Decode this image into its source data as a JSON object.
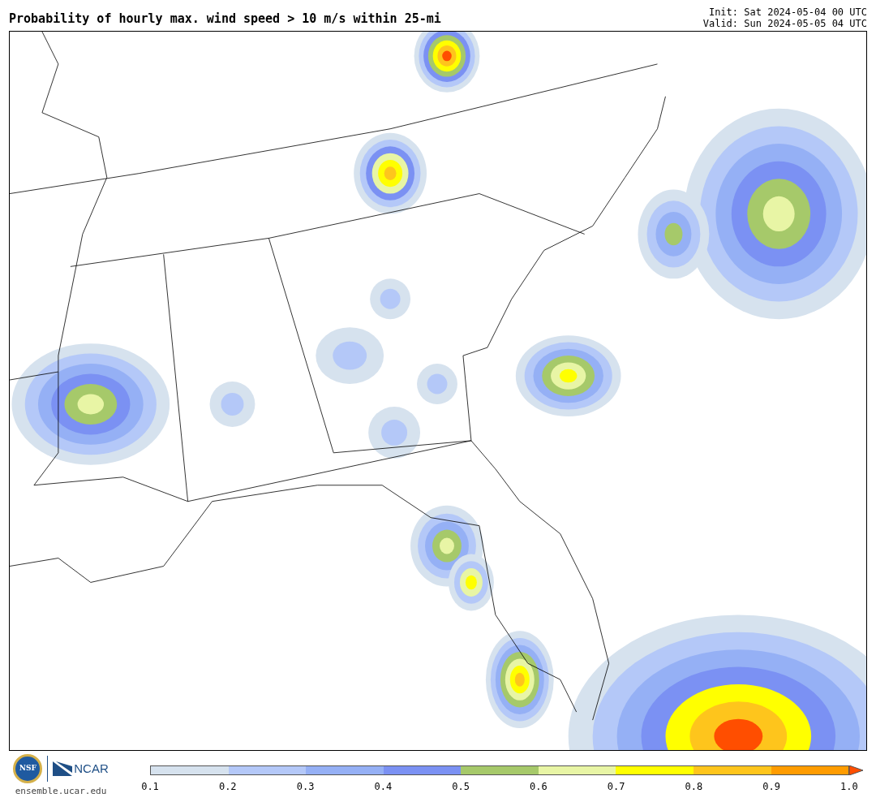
{
  "title": "Probability of hourly max. wind speed > 10 m/s within 25-mi",
  "init": "Init: Sat 2024-05-04 00 UTC",
  "valid": "Valid: Sun 2024-05-05 04 UTC",
  "logos": {
    "nsf": "NSF",
    "ncar": "NCAR",
    "url": "ensemble.ucar.edu"
  },
  "colorbar": {
    "segments": [
      {
        "color": "#d6e2ee"
      },
      {
        "color": "#b4c8f8"
      },
      {
        "color": "#95b0f5"
      },
      {
        "color": "#7b91f3"
      },
      {
        "color": "#a6c96a"
      },
      {
        "color": "#e8f5a5"
      },
      {
        "color": "#ffff00"
      },
      {
        "color": "#fec51c"
      },
      {
        "color": "#ff9c00"
      }
    ],
    "arrow": {
      "color": "#ff4e00"
    },
    "ticks": [
      "0.1",
      "0.2",
      "0.3",
      "0.4",
      "0.5",
      "0.6",
      "0.7",
      "0.8",
      "0.9",
      "1.0"
    ]
  }
}
